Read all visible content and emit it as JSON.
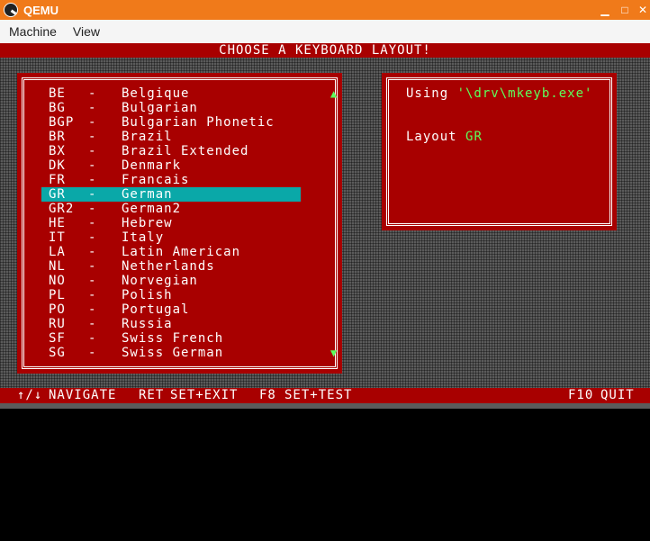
{
  "window": {
    "title": "QEMU",
    "min_glyph": "▁",
    "max_glyph": "□",
    "close_glyph": "✕"
  },
  "menu": [
    "Machine",
    "View"
  ],
  "screen": {
    "header": "CHOOSE A KEYBOARD LAYOUT!",
    "layouts": [
      {
        "code": "BE",
        "name": "Belgique"
      },
      {
        "code": "BG",
        "name": "Bulgarian"
      },
      {
        "code": "BGP",
        "name": "Bulgarian Phonetic"
      },
      {
        "code": "BR",
        "name": "Brazil"
      },
      {
        "code": "BX",
        "name": "Brazil Extended"
      },
      {
        "code": "DK",
        "name": "Denmark"
      },
      {
        "code": "FR",
        "name": "Francais"
      },
      {
        "code": "GR",
        "name": "German"
      },
      {
        "code": "GR2",
        "name": "German2"
      },
      {
        "code": "HE",
        "name": "Hebrew"
      },
      {
        "code": "IT",
        "name": "Italy"
      },
      {
        "code": "LA",
        "name": "Latin American"
      },
      {
        "code": "NL",
        "name": "Netherlands"
      },
      {
        "code": "NO",
        "name": "Norvegian"
      },
      {
        "code": "PL",
        "name": "Polish"
      },
      {
        "code": "PO",
        "name": "Portugal"
      },
      {
        "code": "RU",
        "name": "Russia"
      },
      {
        "code": "SF",
        "name": "Swiss French"
      },
      {
        "code": "SG",
        "name": "Swiss German"
      }
    ],
    "dash": "-",
    "selected_index": 7,
    "scroll_up": "▲",
    "scroll_down": "▼",
    "info": {
      "using_label": "Using ",
      "using_value": "'\\drv\\mkeyb.exe'",
      "layout_label": "Layout ",
      "layout_value": "GR"
    },
    "footer": {
      "nav_keys": "↑/↓",
      "nav_label": "NAVIGATE",
      "ret_key": "RET",
      "ret_label": "SET+EXIT",
      "f8_key": "F8",
      "f8_label": "SET+TEST",
      "f10_key": "F10",
      "f10_label": "QUIT"
    }
  },
  "colors": {
    "titlebar": "#f07a1a",
    "panel": "#a80000",
    "highlight": "#0aa8a8",
    "accent_green": "#5cff5c"
  }
}
